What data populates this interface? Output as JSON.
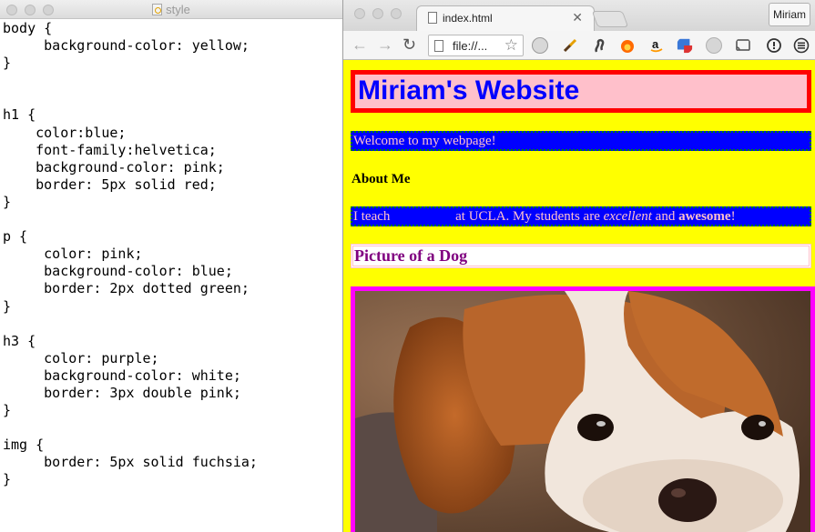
{
  "editor": {
    "title": "style",
    "code_lines": [
      "body {",
      "     background-color: yellow;",
      "}",
      "",
      "",
      "h1 {",
      "    color:blue;",
      "    font-family:helvetica;",
      "    background-color: pink;",
      "    border: 5px solid red;",
      "}",
      "",
      "p {",
      "     color: pink;",
      "     background-color: blue;",
      "     border: 2px dotted green;",
      "}",
      "",
      "h3 {",
      "     color: purple;",
      "     background-color: white;",
      "     border: 3px double pink;",
      "}",
      "",
      "img {",
      "     border: 5px solid fuchsia;",
      "}"
    ]
  },
  "browser": {
    "tab_title": "index.html",
    "tab_close": "✕",
    "user_button": "Miriam",
    "address": "file://...",
    "nav_back": "←",
    "nav_forward": "→",
    "nav_reload": "↻",
    "star": "☆",
    "extension_icons": [
      "hand-icon",
      "brush-icon",
      "puzzle-icon",
      "fire-icon",
      "amazon-icon",
      "calendar-icon",
      "h-icon",
      "cast-icon",
      "info-icon",
      "menu-icon"
    ]
  },
  "page": {
    "h1": "Miriam's Website",
    "p1": "Welcome to my webpage!",
    "about": "About Me",
    "p2": {
      "a": "I teach",
      "b": "at UCLA. My students are",
      "c": "excellent",
      "d": "and",
      "e": "awesome",
      "f": "!"
    },
    "h3": "Picture of a Dog"
  },
  "colors": {
    "page_bg": "#ffff00",
    "h1_text": "#0000ff",
    "h1_bg": "#ffc0cb",
    "h1_border": "#ff0000",
    "p_text": "#ffc0cb",
    "p_bg": "#0000ff",
    "p_border": "#008000",
    "h3_text": "#800080",
    "h3_bg": "#ffffff",
    "h3_border": "#ffc0cb",
    "img_border": "#ff00ff"
  }
}
